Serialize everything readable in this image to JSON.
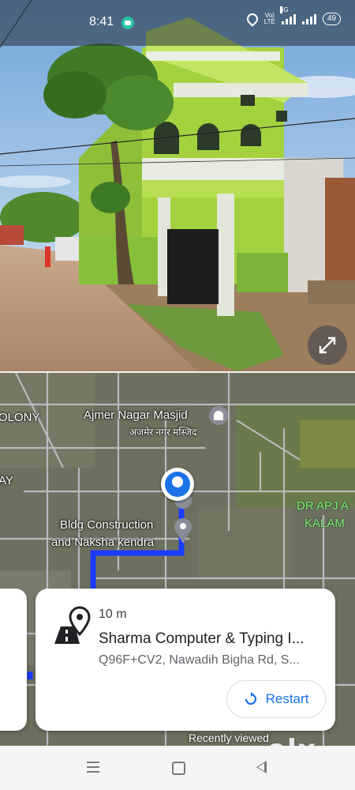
{
  "status_bar": {
    "time": "8:41",
    "volte_label": "Vo)\nLTE",
    "network_label": "4G",
    "battery": "49"
  },
  "street_view": {
    "expand_icon": "expand-arrows-icon"
  },
  "map": {
    "labels": {
      "colony": "OLONY",
      "ay": "AY",
      "masjid": "Ajmer Nagar Masjid",
      "masjid_hindi": "अजमेर नगर मस्जिद",
      "bldg_line1": "Bldg Construction",
      "bldg_line2": "and Naksha kendra",
      "apj_line1": "DR APJ A",
      "apj_line2": "KALAM"
    },
    "route_color": "#1a3cff"
  },
  "place_card": {
    "distance": "10 m",
    "title": "Sharma Computer & Typing I...",
    "address": "Q96F+CV2, Nawadih Bigha Rd, S...",
    "restart_label": "Restart",
    "icon": "roadway-pin-icon"
  },
  "overlay": {
    "recently_viewed": "Recently viewed",
    "watermark": "olx"
  },
  "colors": {
    "accent": "#1a73e8",
    "building_green": "#9ccc3c"
  }
}
